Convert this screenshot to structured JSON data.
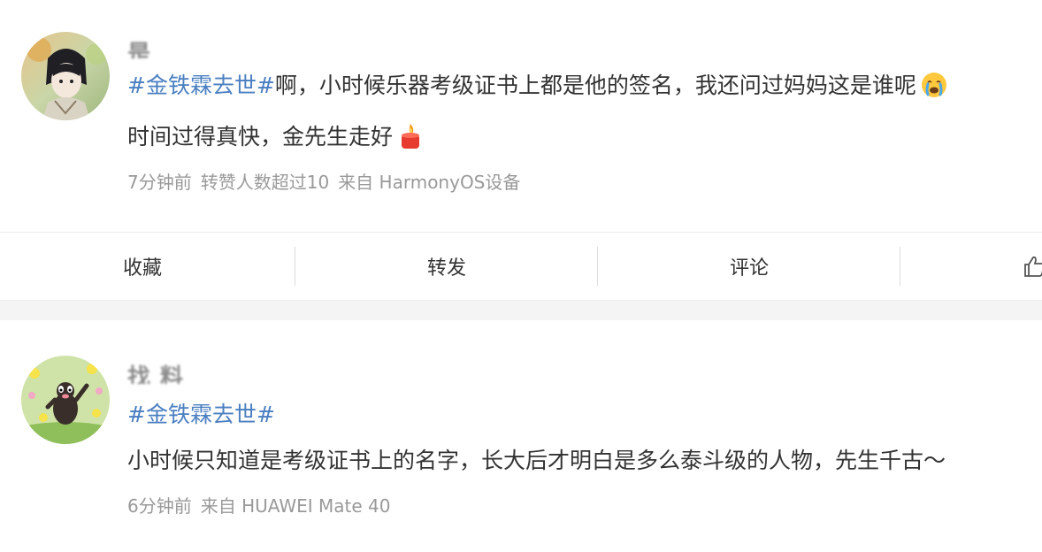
{
  "posts": [
    {
      "username": "是                    ",
      "hashtag": "#金铁霖去世#",
      "text_line1": "啊，小时候乐器考级证书上都是他的签名，我还问过妈妈这是谁呢",
      "emoji1": "crying-face-icon",
      "text_line2": "时间过得真快，金先生走好",
      "emoji2": "candle-icon",
      "time": "7分钟前",
      "reposts": "转赞人数超过10",
      "source": "来自 HarmonyOS设备"
    },
    {
      "username": "找                    料",
      "hashtag": "#金铁霖去世#",
      "text_line1": "小时候只知道是考级证书上的名字，长大后才明白是多么泰斗级的人物，先生千古～",
      "time": "6分钟前",
      "source": "来自 HUAWEI Mate 40"
    }
  ],
  "actions": {
    "favorite": "收藏",
    "repost": "转发",
    "comment": "评论",
    "like_icon": "thumbs-up-icon"
  },
  "colors": {
    "hashtag": "#4a7fc1",
    "meta": "#999999",
    "text": "#333333",
    "gap": "#f4f4f4"
  }
}
